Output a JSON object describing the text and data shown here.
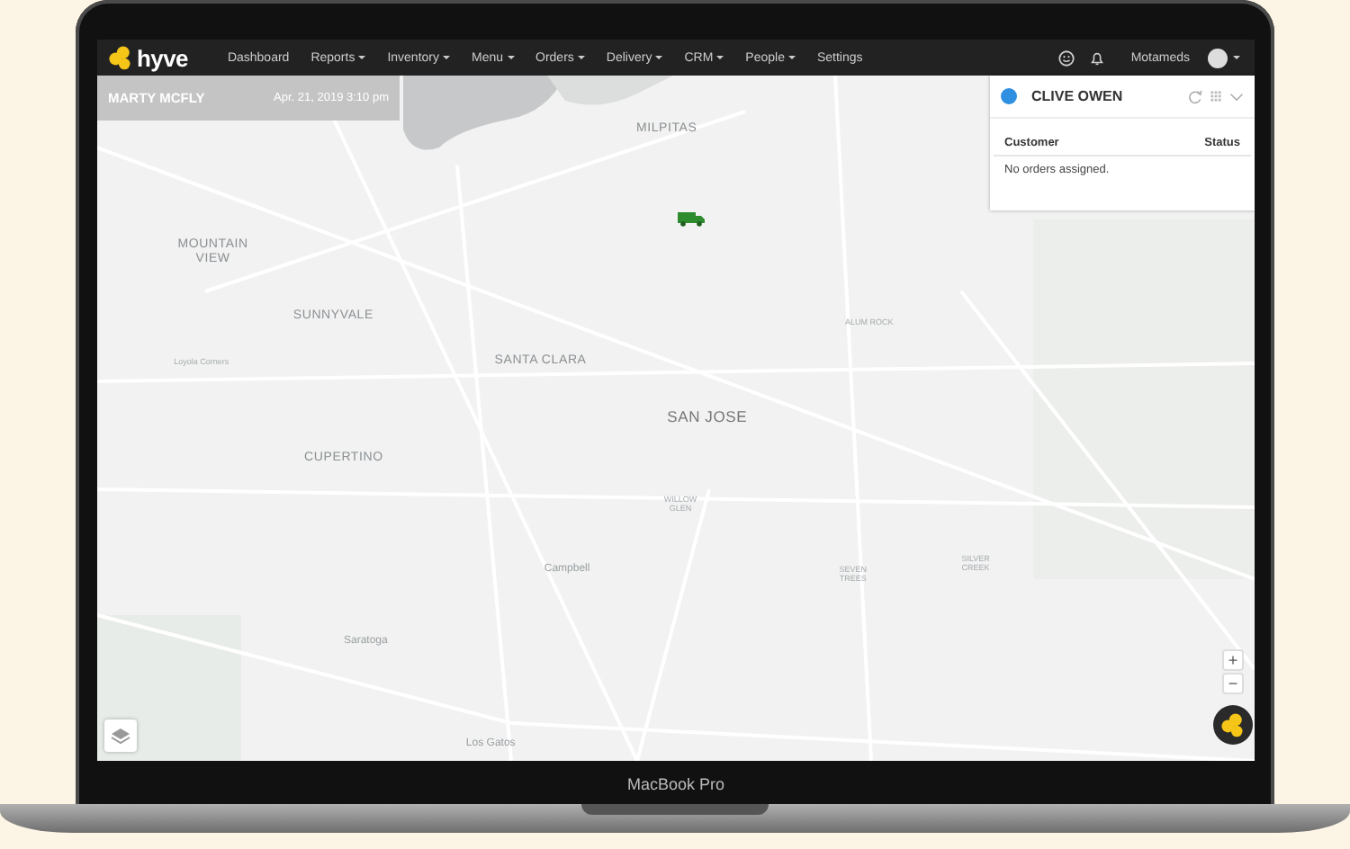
{
  "laptop": {
    "model_label": "MacBook Pro"
  },
  "app": {
    "logo": "hyve",
    "nav": [
      {
        "label": "Dashboard",
        "dropdown": false
      },
      {
        "label": "Reports",
        "dropdown": true
      },
      {
        "label": "Inventory",
        "dropdown": true
      },
      {
        "label": "Menu",
        "dropdown": true
      },
      {
        "label": "Orders",
        "dropdown": true
      },
      {
        "label": "Delivery",
        "dropdown": true
      },
      {
        "label": "CRM",
        "dropdown": true
      },
      {
        "label": "People",
        "dropdown": true
      },
      {
        "label": "Settings",
        "dropdown": false
      }
    ],
    "account": "Motameds"
  },
  "driver_bar": {
    "name": "MARTY MCFLY",
    "timestamp": "Apr. 21, 2019 3:10 pm"
  },
  "map": {
    "labels": [
      {
        "text": "MILPITAS",
        "kind": "city"
      },
      {
        "text": "MOUNTAIN\nVIEW",
        "kind": "city"
      },
      {
        "text": "SUNNYVALE",
        "kind": "city"
      },
      {
        "text": "SANTA CLARA",
        "kind": "city"
      },
      {
        "text": "SAN JOSE",
        "kind": "major"
      },
      {
        "text": "CUPERTINO",
        "kind": "city"
      },
      {
        "text": "Loyola Corners",
        "kind": "small"
      },
      {
        "text": "ALUM ROCK",
        "kind": "small"
      },
      {
        "text": "WILLOW\nGLEN",
        "kind": "small"
      },
      {
        "text": "Campbell",
        "kind": "town"
      },
      {
        "text": "Saratoga",
        "kind": "town"
      },
      {
        "text": "SEVEN\nTREES",
        "kind": "small"
      },
      {
        "text": "SILVER\nCREEK",
        "kind": "small"
      },
      {
        "text": "Los Gatos",
        "kind": "town"
      }
    ]
  },
  "orders_panel": {
    "driver": "CLIVE OWEN",
    "columns": [
      "Customer",
      "Status"
    ],
    "empty_message": "No orders assigned."
  },
  "zoom_controls": [
    "+",
    "−"
  ]
}
